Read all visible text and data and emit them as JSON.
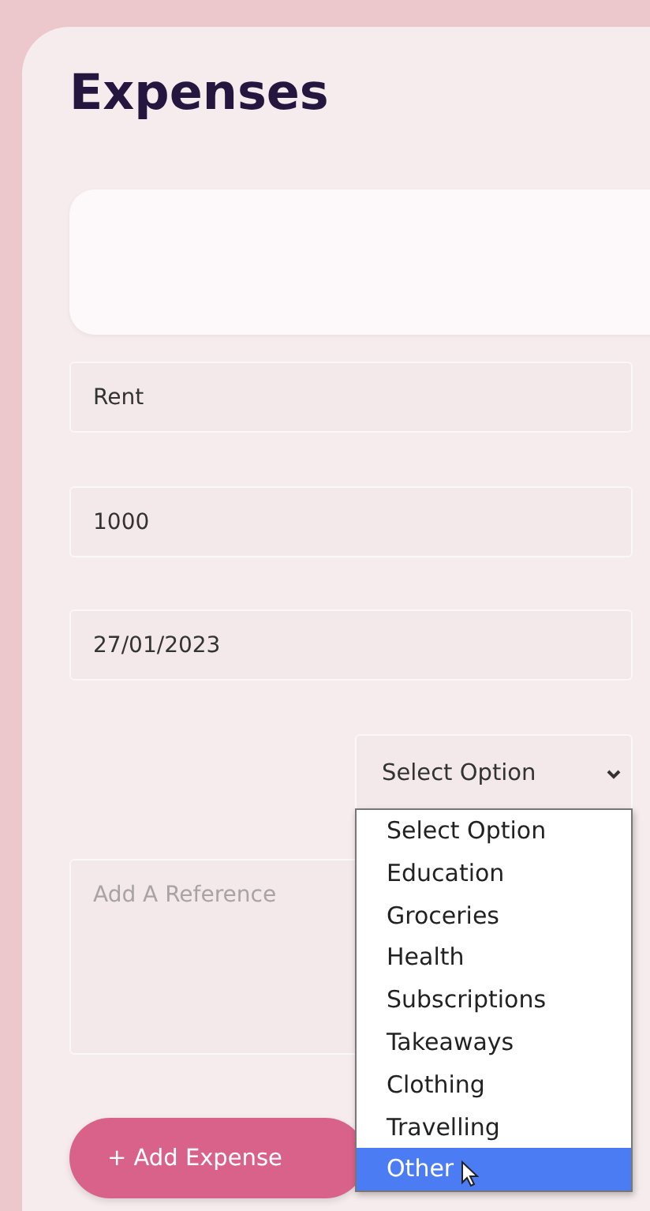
{
  "title": "Expenses",
  "fields": [
    {
      "value": "Rent"
    },
    {
      "value": "1000"
    },
    {
      "value": "27/01/2023"
    }
  ],
  "category_select": {
    "value": "Select Option",
    "expanded": true,
    "options": [
      {
        "label": "Select Option",
        "highlighted": false
      },
      {
        "label": "Education",
        "highlighted": false
      },
      {
        "label": "Groceries",
        "highlighted": false
      },
      {
        "label": "Health",
        "highlighted": false
      },
      {
        "label": "Subscriptions",
        "highlighted": false
      },
      {
        "label": "Takeaways",
        "highlighted": false
      },
      {
        "label": "Clothing",
        "highlighted": false
      },
      {
        "label": "Travelling",
        "highlighted": false
      },
      {
        "label": "Other",
        "highlighted": true
      }
    ]
  },
  "reference": {
    "placeholder": "Add A Reference"
  },
  "add_button": {
    "label": "+ Add Expense"
  }
}
